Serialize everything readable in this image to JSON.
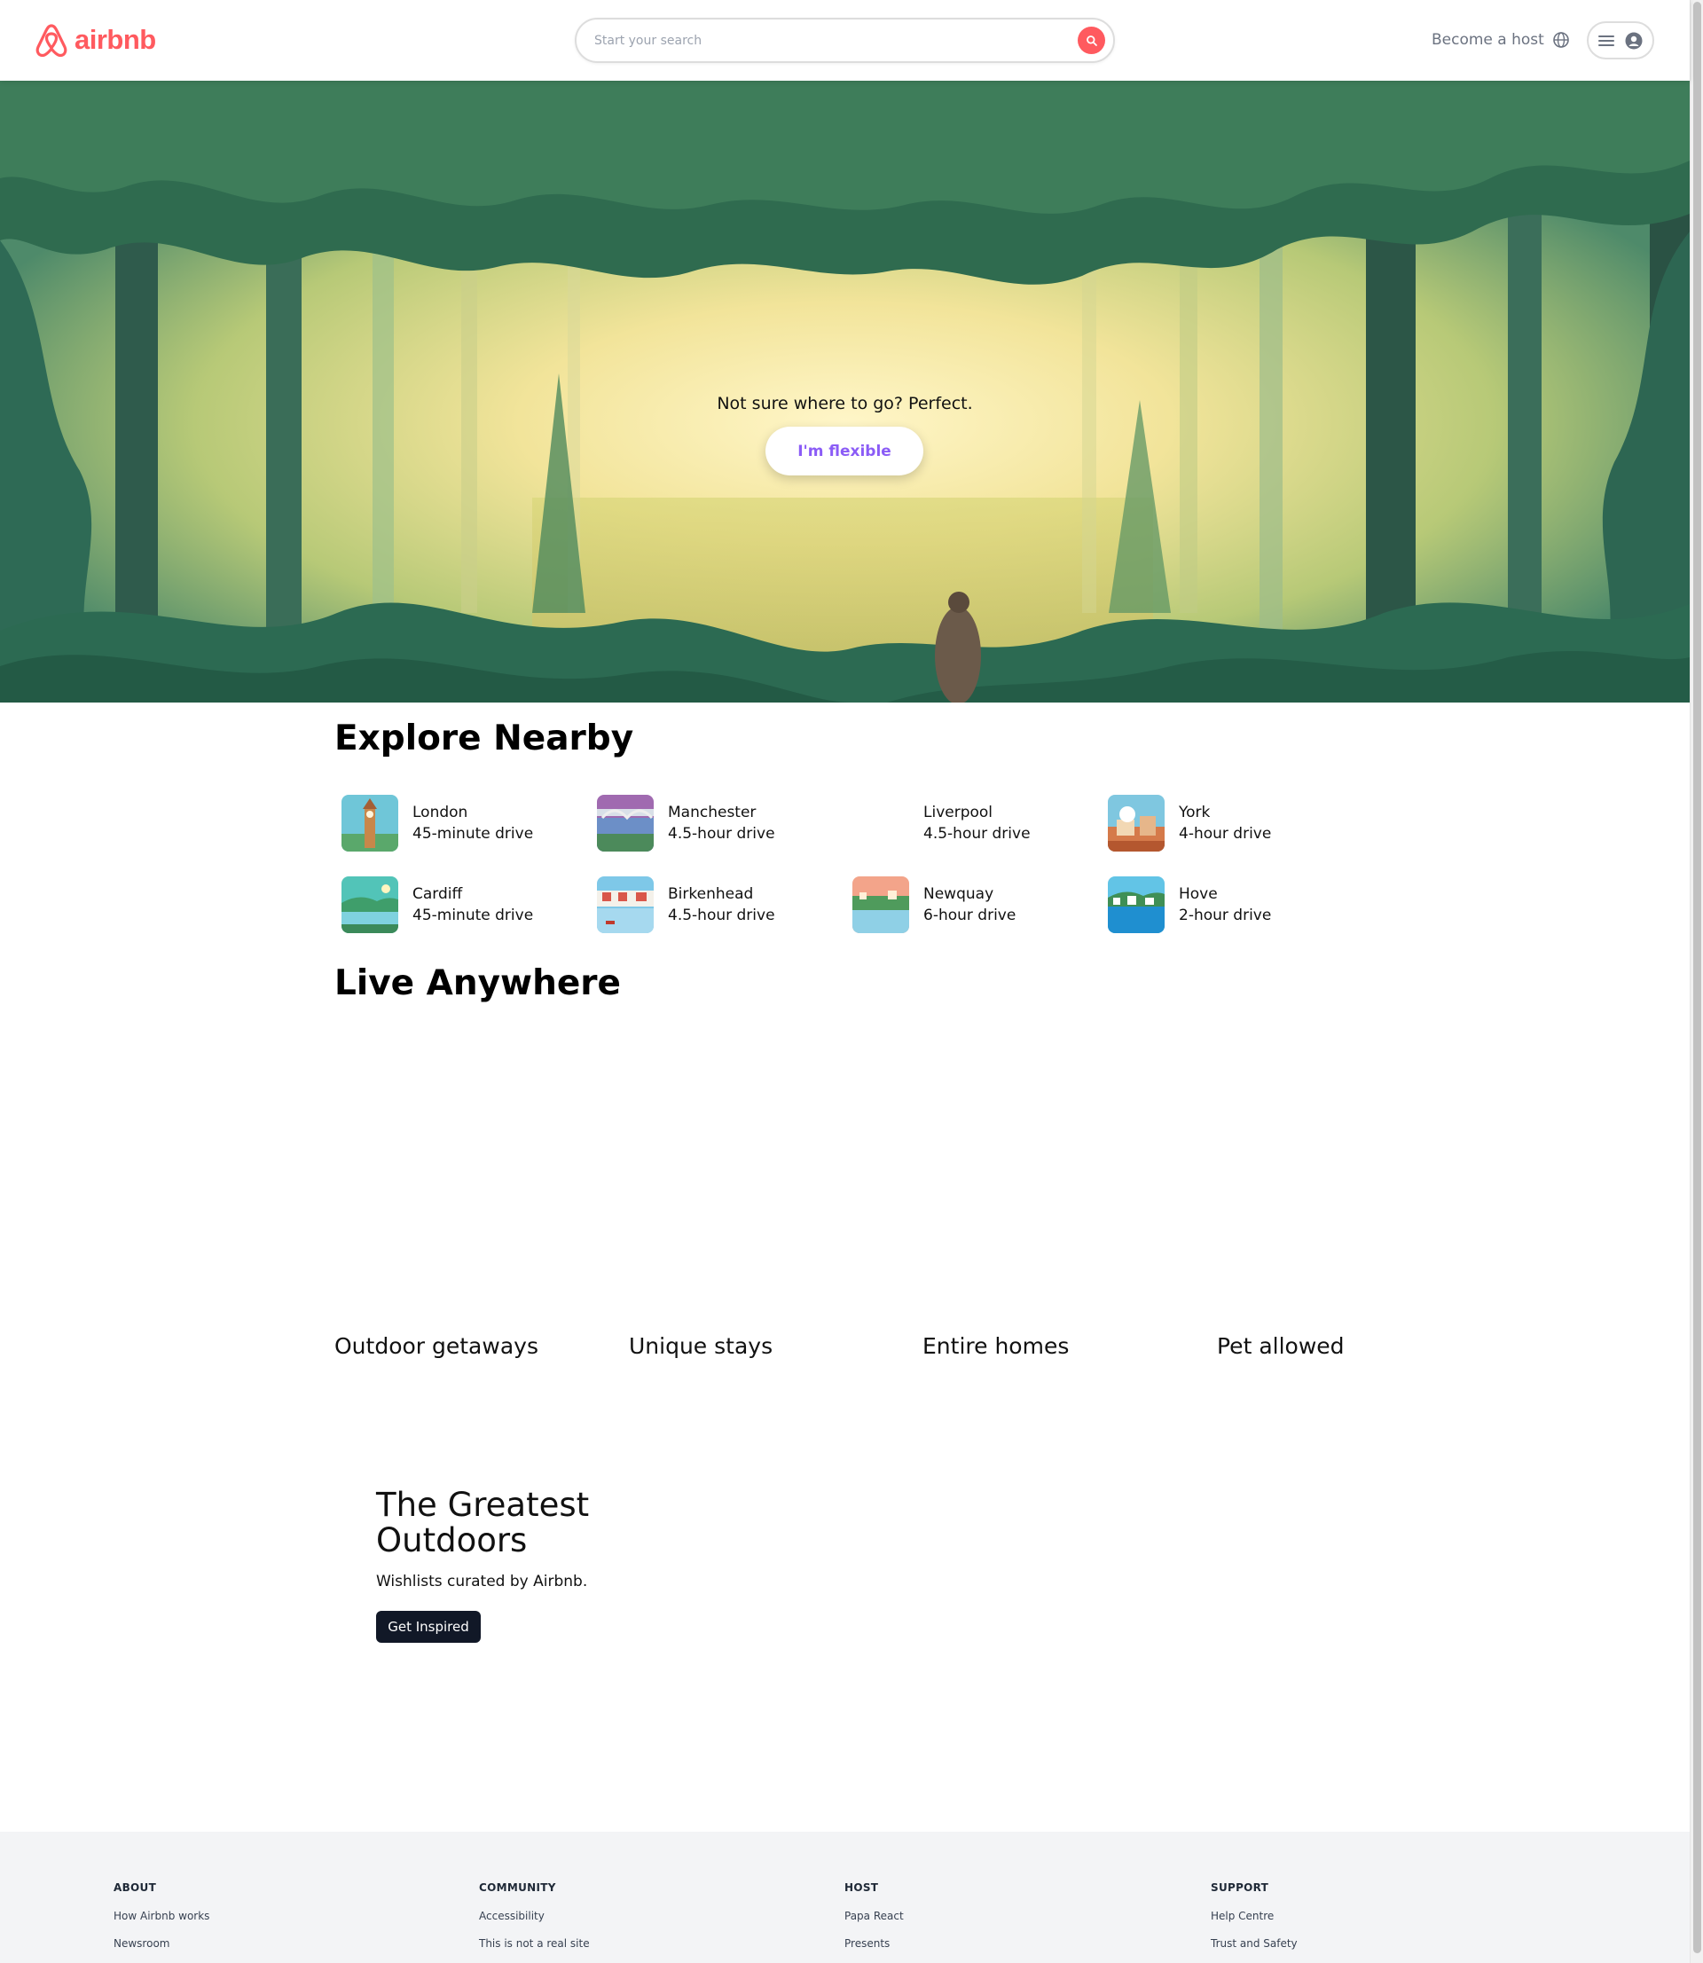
{
  "header": {
    "logo_text": "airbnb",
    "search_placeholder": "Start your search",
    "become_host": "Become a host",
    "brand_color": "#ff5a5f"
  },
  "hero": {
    "tagline": "Not sure where to go? Perfect.",
    "button_label": "I'm flexible",
    "button_color": "#8b5cf6"
  },
  "explore": {
    "title": "Explore Nearby",
    "items": [
      {
        "city": "London",
        "distance": "45-minute drive"
      },
      {
        "city": "Manchester",
        "distance": "4.5-hour drive"
      },
      {
        "city": "Liverpool",
        "distance": "4.5-hour drive"
      },
      {
        "city": "York",
        "distance": "4-hour drive"
      },
      {
        "city": "Cardiff",
        "distance": "45-minute drive"
      },
      {
        "city": "Birkenhead",
        "distance": "4.5-hour drive"
      },
      {
        "city": "Newquay",
        "distance": "6-hour drive"
      },
      {
        "city": "Hove",
        "distance": "2-hour drive"
      }
    ]
  },
  "live": {
    "title": "Live Anywhere",
    "cards": [
      "Outdoor getaways",
      "Unique stays",
      "Entire homes",
      "Pet allowed"
    ]
  },
  "banner": {
    "title": "The Greatest Outdoors",
    "subtitle": "Wishlists curated by Airbnb.",
    "button_label": "Get Inspired"
  },
  "footer": {
    "columns": [
      {
        "heading": "ABOUT",
        "links": [
          "How Airbnb works",
          "Newsroom"
        ]
      },
      {
        "heading": "COMMUNITY",
        "links": [
          "Accessibility",
          "This is not a real site"
        ]
      },
      {
        "heading": "HOST",
        "links": [
          "Papa React",
          "Presents"
        ]
      },
      {
        "heading": "SUPPORT",
        "links": [
          "Help Centre",
          "Trust and Safety"
        ]
      }
    ]
  },
  "icons": [
    "airbnb-logo-icon",
    "search-icon",
    "globe-icon",
    "menu-icon",
    "user-icon"
  ]
}
